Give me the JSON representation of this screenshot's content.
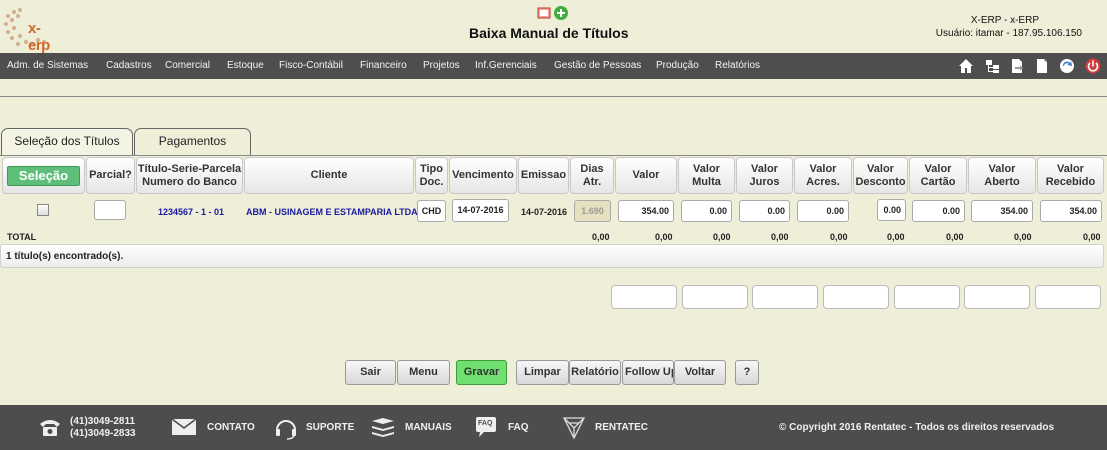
{
  "header": {
    "logo_text": "x-erp",
    "title": "Baixa Manual de Títulos",
    "user_company": "X-ERP - x-ERP",
    "user_info": "Usuário: itamar - 187.95.106.150"
  },
  "menu": {
    "items": [
      "Adm. de Sistemas",
      "Cadastros",
      "Comercial",
      "Estoque",
      "Fisco-Contábil",
      "Financeiro",
      "Projetos",
      "Inf.Gerenciais",
      "Gestão de Pessoas",
      "Produção",
      "Relatórios"
    ],
    "toolbar_icons": [
      "home-icon",
      "tree-icon",
      "export-icon",
      "document-icon",
      "refresh-icon",
      "power-icon"
    ]
  },
  "tabs": [
    {
      "label": "Seleção dos Títulos",
      "active": true
    },
    {
      "label": "Pagamentos",
      "active": false
    }
  ],
  "table": {
    "select_button": "Seleção",
    "headers": {
      "parcial": "Parcial?",
      "titulo_l1": "Título-Serie-Parcela",
      "titulo_l2": "Numero do Banco",
      "cliente": "Cliente",
      "tipo_l1": "Tipo",
      "tipo_l2": "Doc.",
      "vencimento": "Vencimento",
      "emissao": "Emissao",
      "dias_l1": "Dias",
      "dias_l2": "Atr.",
      "valor": "Valor",
      "multa_l1": "Valor",
      "multa_l2": "Multa",
      "juros_l1": "Valor",
      "juros_l2": "Juros",
      "acres_l1": "Valor",
      "acres_l2": "Acres.",
      "desc_l1": "Valor",
      "desc_l2": "Desconto",
      "cartao_l1": "Valor",
      "cartao_l2": "Cartão",
      "aberto_l1": "Valor",
      "aberto_l2": "Aberto",
      "receb_l1": "Valor",
      "receb_l2": "Recebido"
    },
    "row": {
      "titulo": "1234567 - 1 - 01",
      "cliente": "ABM - USINAGEM E ESTAMPARIA LTDA.",
      "tipo_doc": "CHD",
      "vencimento": "14-07-2016",
      "emissao": "14-07-2016",
      "dias_atr": "1.690",
      "valor": "354.00",
      "multa": "0.00",
      "juros": "0.00",
      "acres": "0.00",
      "desconto": "0.00",
      "cartao": "0.00",
      "aberto": "354.00",
      "recebido": "354.00"
    },
    "total": {
      "label": "TOTAL",
      "valor": "0,00",
      "multa": "0,00",
      "juros": "0,00",
      "acres": "0,00",
      "desconto": "0,00",
      "cartao": "0,00",
      "aberto": "0,00",
      "recebido": "0,00"
    },
    "found": "1 título(s) encontrado(s)."
  },
  "buttons": {
    "sair": "Sair",
    "menu": "Menu",
    "gravar": "Gravar",
    "limpar": "Limpar",
    "relatorio": "Relatório",
    "follow_up": "Follow Up",
    "voltar": "Voltar",
    "help": "?"
  },
  "footer": {
    "phone1": "(41)3049-2811",
    "phone2": "(41)3049-2833",
    "contato": "CONTATO",
    "suporte": "SUPORTE",
    "manuais": "MANUAIS",
    "faq": "FAQ",
    "faq_badge": "FAQ",
    "rentatec": "RENTATEC",
    "copyright": "© Copyright 2016 Rentatec - Todos os direitos reservados"
  },
  "colors": {
    "background": "#eeeed9",
    "menubar": "#4e4e4e",
    "select_button": "#5fbf7a",
    "save_button": "#6fe06f",
    "link_blue": "#1a1aa0"
  }
}
